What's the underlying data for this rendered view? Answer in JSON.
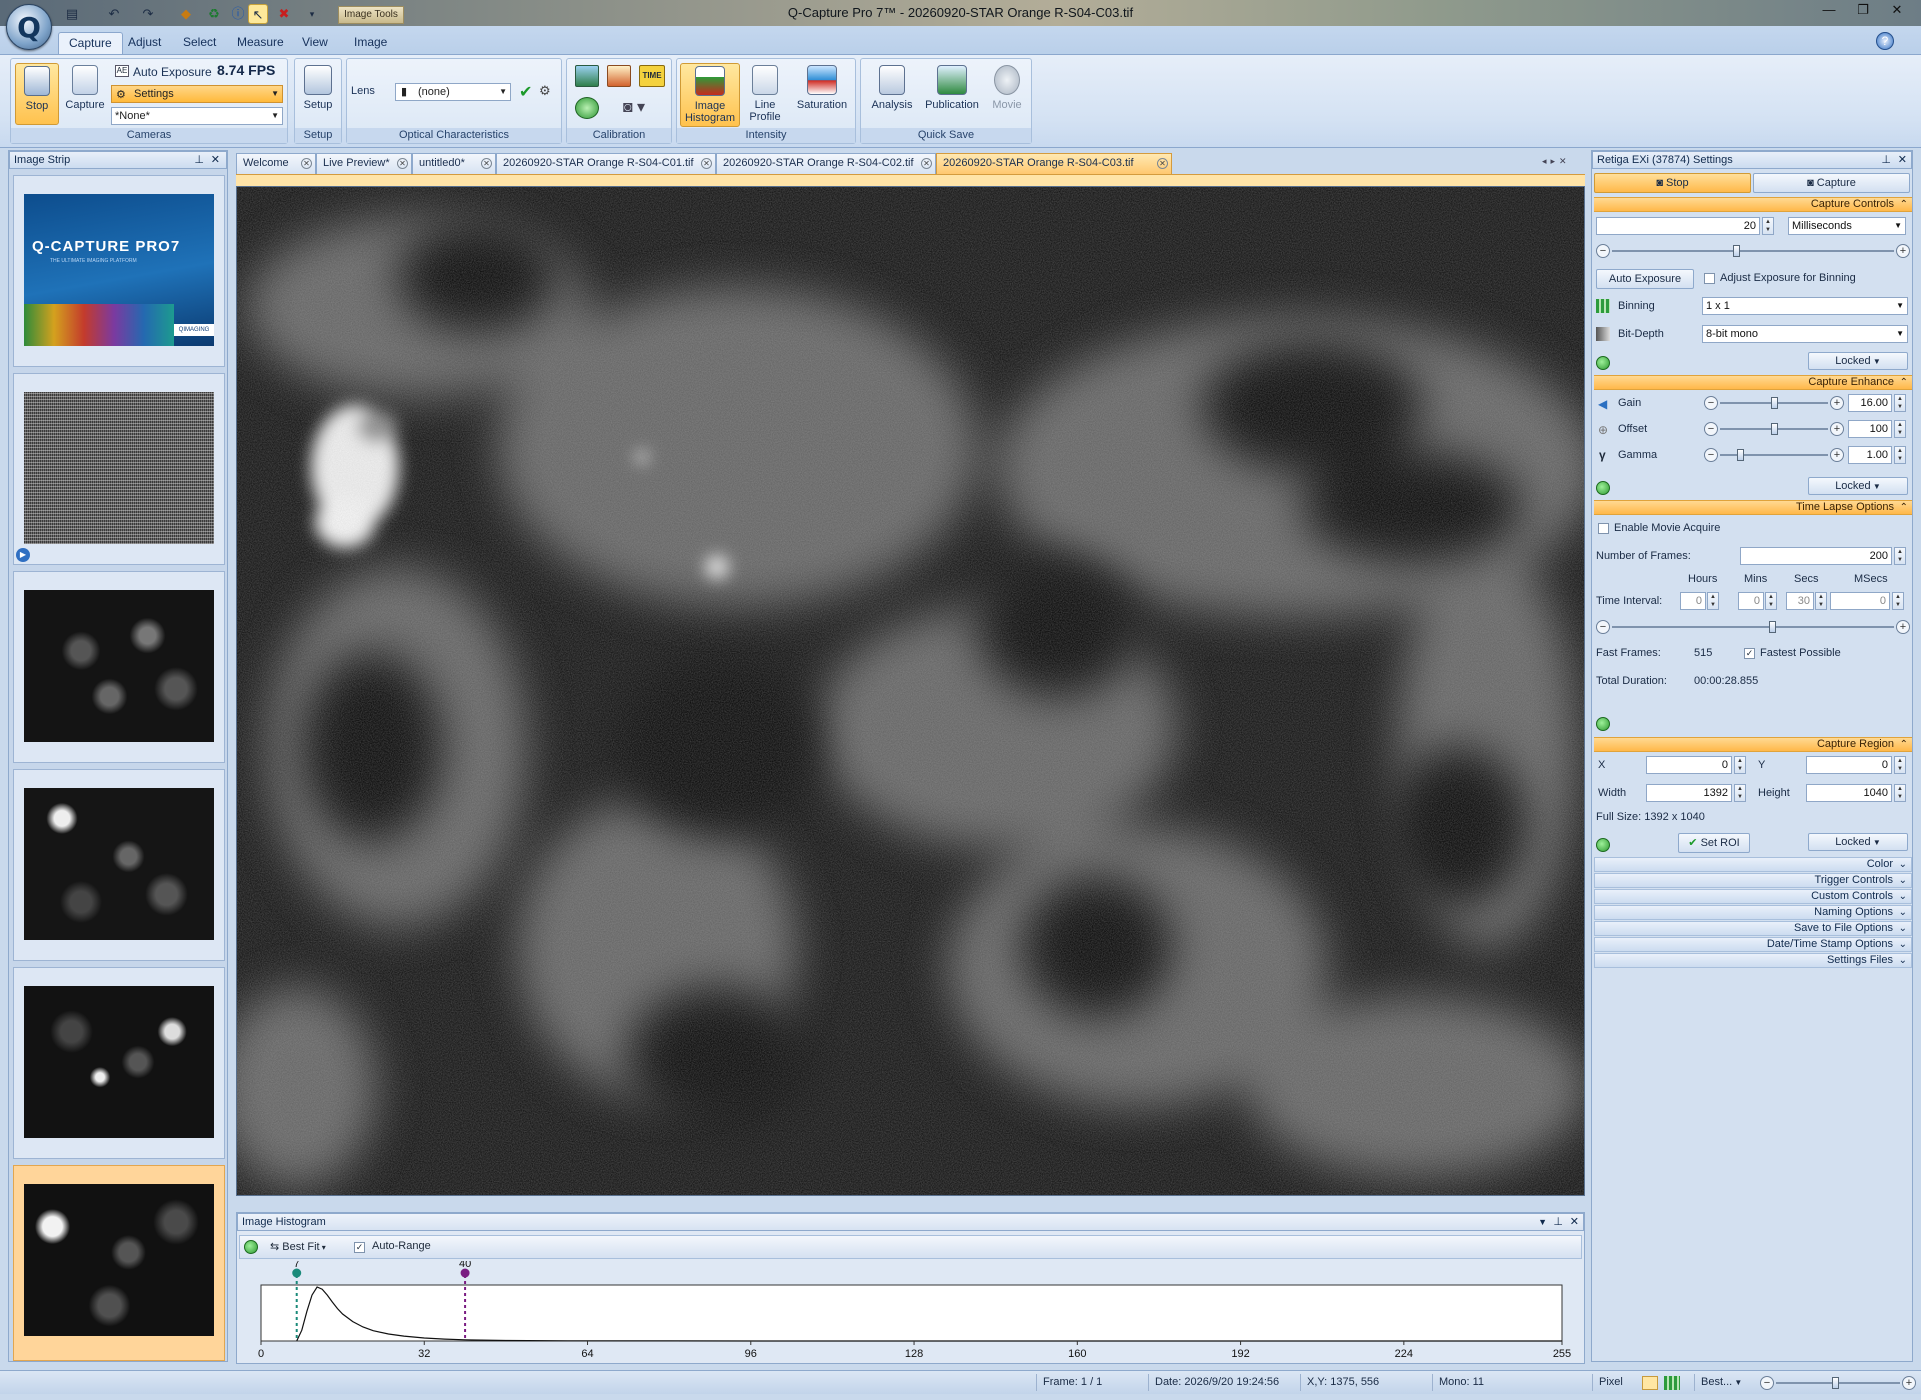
{
  "window": {
    "title": "Q-Capture Pro 7™ - 20260920-STAR Orange R-S04-C03.tif",
    "image_tools_label": "Image Tools"
  },
  "ribbon": {
    "tabs": [
      {
        "label": "Capture",
        "active": true
      },
      {
        "label": "Adjust"
      },
      {
        "label": "Select"
      },
      {
        "label": "Measure"
      },
      {
        "label": "View"
      },
      {
        "label": "Image"
      }
    ],
    "cameras": {
      "stop_label": "Stop",
      "capture_label": "Capture",
      "auto_exposure_label": "Auto Exposure",
      "fps": "8.74 FPS",
      "settings_combo": "Settings",
      "none_combo": "*None*",
      "group_label": "Cameras"
    },
    "setup": {
      "label": "Setup",
      "group_label": "Setup"
    },
    "optical": {
      "lens_label": "Lens",
      "lens_value": "(none)",
      "group_label": "Optical Characteristics"
    },
    "calibration": {
      "group_label": "Calibration",
      "tag": "TIME"
    },
    "intensity": {
      "image_histogram": "Image Histogram",
      "line_profile": "Line Profile",
      "saturation": "Saturation",
      "group_label": "Intensity"
    },
    "quick_save": {
      "analysis": "Analysis",
      "publication": "Publication",
      "movie": "Movie",
      "group_label": "Quick Save"
    }
  },
  "image_strip": {
    "title": "Image Strip",
    "splash": {
      "logo": "Q-CAPTURE PRO7",
      "tagline": "THE ULTIMATE IMAGING PLATFORM",
      "brand": "QIMAGING"
    }
  },
  "doc_tabs": [
    {
      "label": "Welcome"
    },
    {
      "label": "Live Preview*"
    },
    {
      "label": "untitled0*"
    },
    {
      "label": "20260920-STAR Orange R-S04-C01.tif"
    },
    {
      "label": "20260920-STAR Orange R-S04-C02.tif"
    },
    {
      "label": "20260920-STAR Orange R-S04-C03.tif",
      "active": true
    }
  ],
  "histogram": {
    "title": "Image Histogram",
    "best_fit": "Best Fit",
    "auto_range": "Auto-Range",
    "low_marker": "7",
    "high_marker": "40",
    "ticks": [
      "0",
      "32",
      "64",
      "96",
      "128",
      "160",
      "192",
      "224",
      "255"
    ],
    "x_range": [
      0,
      255
    ],
    "low_value": 7,
    "high_value": 40,
    "curve": [
      [
        7,
        0
      ],
      [
        8,
        0.2
      ],
      [
        9,
        0.55
      ],
      [
        10,
        0.85
      ],
      [
        11,
        1
      ],
      [
        12,
        0.96
      ],
      [
        13,
        0.85
      ],
      [
        14,
        0.72
      ],
      [
        15,
        0.6
      ],
      [
        16,
        0.5
      ],
      [
        18,
        0.36
      ],
      [
        20,
        0.26
      ],
      [
        22,
        0.19
      ],
      [
        25,
        0.13
      ],
      [
        28,
        0.09
      ],
      [
        32,
        0.055
      ],
      [
        36,
        0.035
      ],
      [
        40,
        0.022
      ],
      [
        48,
        0.01
      ],
      [
        60,
        0.004
      ],
      [
        80,
        0.001
      ],
      [
        100,
        0
      ]
    ]
  },
  "settings_panel": {
    "title": "Retiga EXi (37874) Settings",
    "stop_tab": "Stop",
    "capture_tab": "Capture",
    "capture_controls": {
      "header": "Capture Controls",
      "exposure_value": "20",
      "exposure_unit": "Milliseconds",
      "exposure_slider": 0.44,
      "auto_exposure_btn": "Auto Exposure",
      "adjust_binning": "Adjust Exposure for Binning",
      "binning_label": "Binning",
      "binning_value": "1 x 1",
      "bitdepth_label": "Bit-Depth",
      "bitdepth_value": "8-bit mono",
      "locked": "Locked"
    },
    "capture_enhance": {
      "header": "Capture Enhance",
      "gain_label": "Gain",
      "gain_value": "16.00",
      "gain_slider": 0.5,
      "offset_label": "Offset",
      "offset_value": "100",
      "offset_slider": 0.5,
      "gamma_label": "Gamma",
      "gamma_value": "1.00",
      "gamma_slider": 0.17,
      "locked": "Locked"
    },
    "time_lapse": {
      "header": "Time Lapse Options",
      "enable_movie": "Enable Movie Acquire",
      "num_frames_label": "Number of Frames:",
      "num_frames": "200",
      "hours_h": "Hours",
      "mins_h": "Mins",
      "secs_h": "Secs",
      "msecs_h": "MSecs",
      "interval_label": "Time Interval:",
      "hours": "0",
      "mins": "0",
      "secs": "30",
      "msecs": "0",
      "interval_slider": 0.57,
      "fast_frames_label": "Fast Frames:",
      "fast_frames": "515",
      "fastest_possible": "Fastest Possible",
      "total_duration_label": "Total Duration:",
      "total_duration": "00:00:28.855"
    },
    "capture_region": {
      "header": "Capture Region",
      "x_label": "X",
      "x": "0",
      "y_label": "Y",
      "y": "0",
      "width_label": "Width",
      "width": "1392",
      "height_label": "Height",
      "height": "1040",
      "full_size": "Full Size: 1392 x 1040",
      "set_roi": "Set ROI",
      "locked": "Locked"
    },
    "collapsed_sections": [
      "Color",
      "Trigger Controls",
      "Custom Controls",
      "Naming Options",
      "Save to File Options",
      "Date/Time Stamp Options",
      "Settings Files"
    ]
  },
  "status_bar": {
    "frame": "Frame: 1 / 1",
    "date": "Date: 2026/9/20 19:24:56",
    "xy": "X,Y: 1375,  556",
    "mono": "Mono:    11",
    "unit": "Pixel",
    "fit": "Best..."
  }
}
